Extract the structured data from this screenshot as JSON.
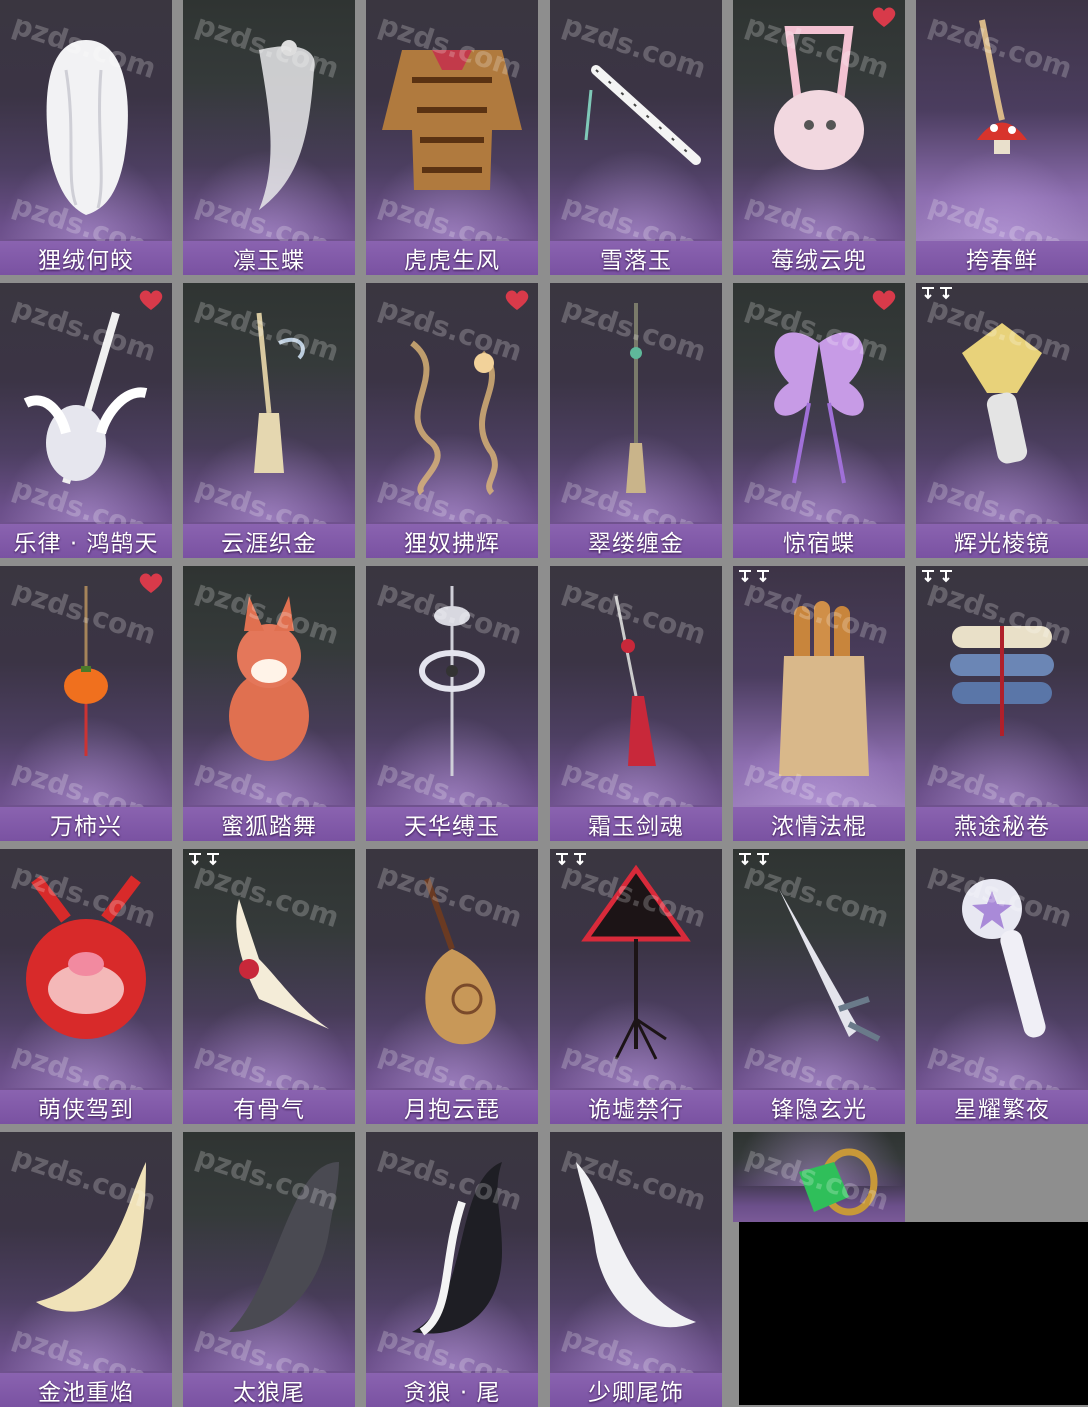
{
  "watermark": "pzds.com",
  "colors": {
    "label_bar": "#7a52a2",
    "heart": "#d83a4a",
    "card_top": "#3a3640",
    "card_bottom": "#7a5a98",
    "page_background": "#8e8e8e",
    "black_box": "#000000"
  },
  "items": [
    {
      "name": "狸绒何皎",
      "icon": "white-hair-icon",
      "favorite": false,
      "bound": false
    },
    {
      "name": "凛玉蝶",
      "icon": "veil-headdress-icon",
      "favorite": false,
      "bound": false
    },
    {
      "name": "虎虎生风",
      "icon": "tiger-costume-icon",
      "favorite": false,
      "bound": false
    },
    {
      "name": "雪落玉",
      "icon": "jade-flute-icon",
      "favorite": false,
      "bound": false
    },
    {
      "name": "莓绒云兜",
      "icon": "pink-bag-icon",
      "favorite": true,
      "bound": false
    },
    {
      "name": "挎春鲜",
      "icon": "mushroom-charm-icon",
      "favorite": false,
      "bound": false
    },
    {
      "name": "乐律 · 鸿鹄天",
      "icon": "winged-guitar-icon",
      "favorite": true,
      "bound": false
    },
    {
      "name": "云涯织金",
      "icon": "tassel-pendant-icon",
      "favorite": false,
      "bound": false
    },
    {
      "name": "狸奴拂辉",
      "icon": "golden-wisps-icon",
      "favorite": true,
      "bound": false
    },
    {
      "name": "翠缕缠金",
      "icon": "jade-tassel-icon",
      "favorite": false,
      "bound": false
    },
    {
      "name": "惊宿蝶",
      "icon": "butterfly-wings-icon",
      "favorite": true,
      "bound": false
    },
    {
      "name": "辉光棱镜",
      "icon": "crystal-scepter-icon",
      "favorite": false,
      "bound": true
    },
    {
      "name": "万柿兴",
      "icon": "persimmon-charm-icon",
      "favorite": true,
      "bound": false
    },
    {
      "name": "蜜狐踏舞",
      "icon": "fox-pet-icon",
      "favorite": false,
      "bound": false
    },
    {
      "name": "天华缚玉",
      "icon": "silver-pendant-icon",
      "favorite": false,
      "bound": false
    },
    {
      "name": "霜玉剑魂",
      "icon": "red-tassel-icon",
      "favorite": false,
      "bound": false
    },
    {
      "name": "浓情法棍",
      "icon": "baguette-bag-icon",
      "favorite": false,
      "bound": true
    },
    {
      "name": "燕途秘卷",
      "icon": "scroll-bundle-icon",
      "favorite": false,
      "bound": true
    },
    {
      "name": "萌侠驾到",
      "icon": "pig-backpack-icon",
      "favorite": false,
      "bound": false
    },
    {
      "name": "有骨气",
      "icon": "bone-charm-icon",
      "favorite": false,
      "bound": true
    },
    {
      "name": "月抱云琵",
      "icon": "pipa-lute-icon",
      "favorite": false,
      "bound": false
    },
    {
      "name": "诡墟禁行",
      "icon": "warning-sign-icon",
      "favorite": false,
      "bound": true
    },
    {
      "name": "锋隐玄光",
      "icon": "dagger-icon",
      "favorite": false,
      "bound": true
    },
    {
      "name": "星耀繁夜",
      "icon": "star-microphone-icon",
      "favorite": false,
      "bound": false
    },
    {
      "name": "金池重焰",
      "icon": "golden-tail-icon",
      "favorite": false,
      "bound": false
    },
    {
      "name": "太狼尾",
      "icon": "grey-wolf-tail-icon",
      "favorite": false,
      "bound": false
    },
    {
      "name": "贪狼 · 尾",
      "icon": "black-white-tail-icon",
      "favorite": false,
      "bound": false
    },
    {
      "name": "少卿尾饰",
      "icon": "white-tail-icon",
      "favorite": false,
      "bound": false
    },
    {
      "name": "",
      "icon": "emerald-ring-icon",
      "favorite": false,
      "bound": false
    }
  ]
}
